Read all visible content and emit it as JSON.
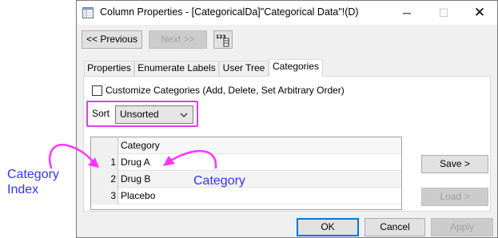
{
  "window": {
    "title": "Column Properties - [CategoricalDa]\"Categorical Data\"!(D)",
    "controls": {
      "minimize": "─",
      "maximize": "☐",
      "close": "✕"
    }
  },
  "toolbar": {
    "previous_label": "<< Previous",
    "next_label": "Next >>",
    "icon_text": "123"
  },
  "tabs": [
    {
      "label": "Properties",
      "active": false
    },
    {
      "label": "Enumerate Labels",
      "active": false
    },
    {
      "label": "User Tree",
      "active": false
    },
    {
      "label": "Categories",
      "active": true
    }
  ],
  "customize": {
    "label": "Customize Categories (Add, Delete, Set Arbitrary Order)",
    "checked": false
  },
  "sort": {
    "label": "Sort",
    "selected": "Unsorted"
  },
  "grid": {
    "header": "Category",
    "rows": [
      {
        "index": "1",
        "value": "Drug A"
      },
      {
        "index": "2",
        "value": "Drug B"
      },
      {
        "index": "3",
        "value": "Placebo"
      }
    ]
  },
  "side_buttons": {
    "save_label": "Save >",
    "load_label": "Load >"
  },
  "footer": {
    "ok_label": "OK",
    "cancel_label": "Cancel",
    "apply_label": "Apply"
  },
  "annotations": {
    "category_index_line1": "Category",
    "category_index_line2": "Index",
    "category_label": "Category",
    "color": "#3333ff",
    "arrow_color": "#ff33ff"
  }
}
